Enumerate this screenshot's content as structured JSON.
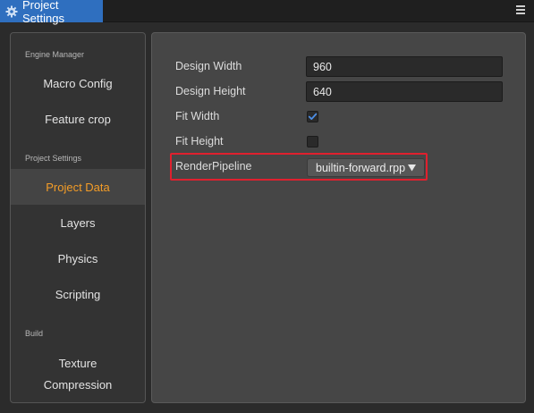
{
  "window": {
    "tab_title": "Project Settings",
    "tab_icon": "gear-icon",
    "menu_icon": "hamburger-menu-icon"
  },
  "sidebar": {
    "sections": [
      {
        "label": "Engine Manager"
      },
      {
        "label": "Project Settings"
      },
      {
        "label": "Build"
      }
    ],
    "items": [
      {
        "label": "Macro Config"
      },
      {
        "label": "Feature crop"
      },
      {
        "label": "Project Data",
        "active": true
      },
      {
        "label": "Layers"
      },
      {
        "label": "Physics"
      },
      {
        "label": "Scripting"
      },
      {
        "label_line1": "Texture",
        "label_line2": "Compression"
      }
    ]
  },
  "form": {
    "design_width": {
      "label": "Design Width",
      "value": "960"
    },
    "design_height": {
      "label": "Design Height",
      "value": "640"
    },
    "fit_width": {
      "label": "Fit Width",
      "checked": true
    },
    "fit_height": {
      "label": "Fit Height",
      "checked": false
    },
    "render_pipeline": {
      "label": "RenderPipeline",
      "value": "builtin-forward.rpp"
    }
  },
  "colors": {
    "accent_tab": "#2f6fbf",
    "active_item": "#f39c27",
    "highlight_border": "#e0202e"
  }
}
